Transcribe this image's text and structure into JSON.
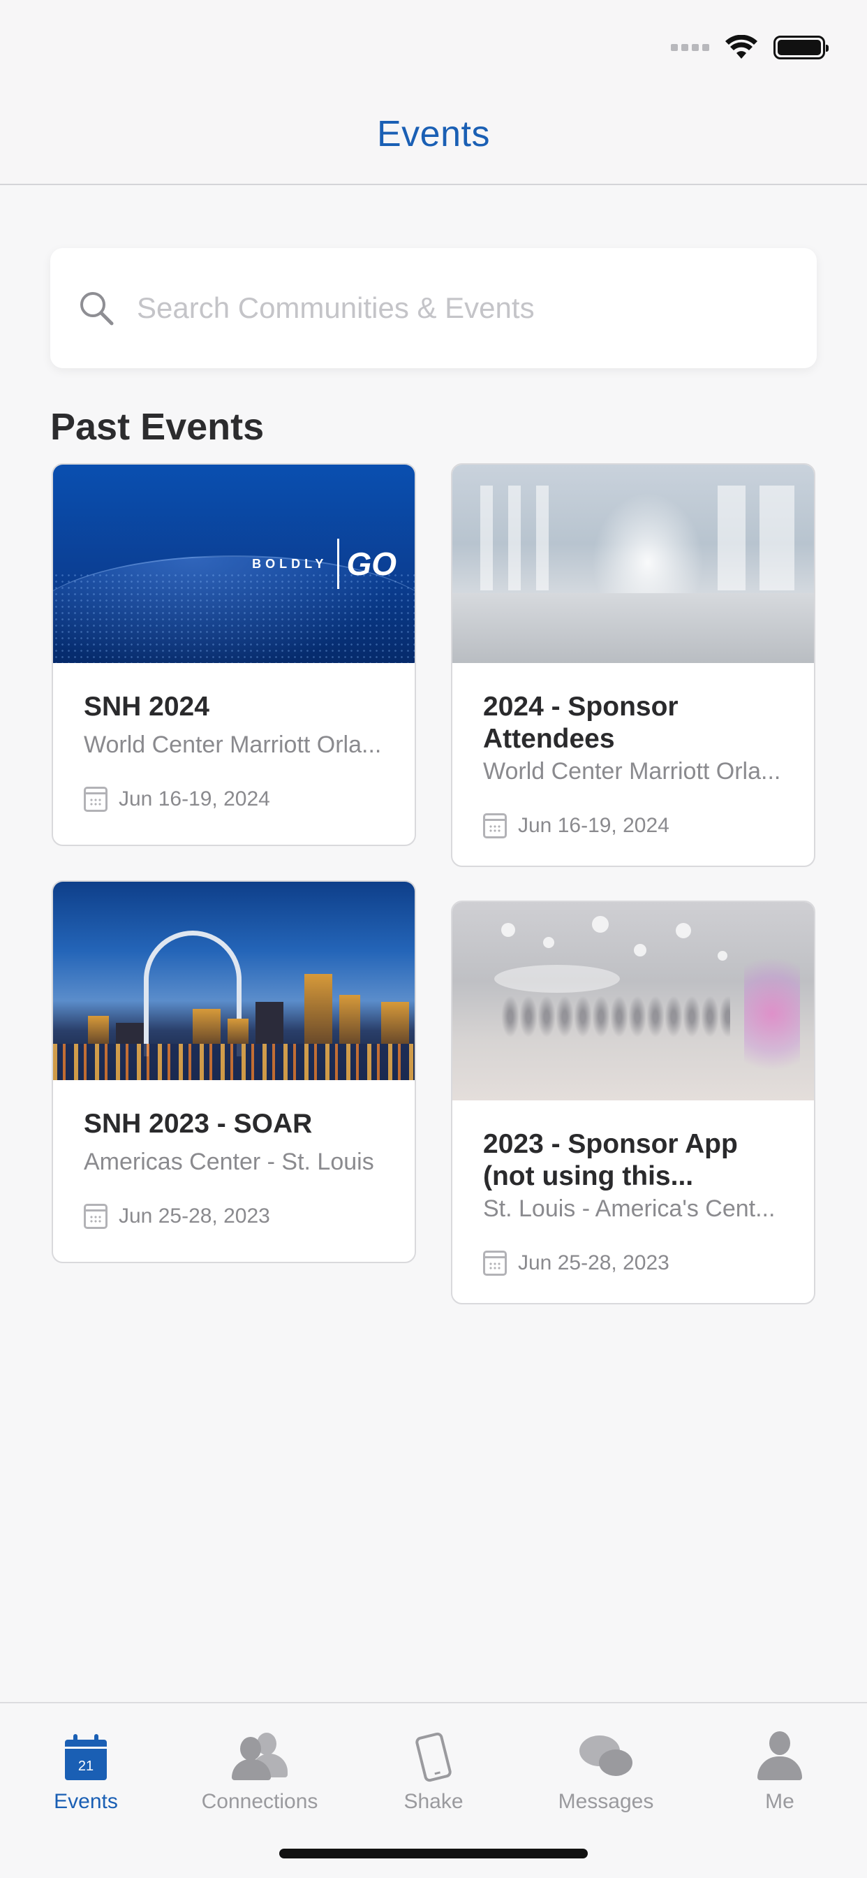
{
  "header": {
    "title": "Events"
  },
  "search": {
    "placeholder": "Search Communities & Events"
  },
  "section": {
    "title": "Past Events"
  },
  "events": [
    {
      "title": "SNH 2024",
      "venue": "World Center Marriott Orla...",
      "date": "Jun 16-19, 2024",
      "image": "boldly-go-banner",
      "logo_small": "BOLDLY",
      "logo_big": "GO"
    },
    {
      "title": "2024 - Sponsor Attendees",
      "venue": "World Center Marriott Orla...",
      "date": "Jun 16-19, 2024",
      "image": "convention-hall-photo"
    },
    {
      "title": "SNH 2023 - SOAR",
      "venue": "Americas Center - St. Louis",
      "date": "Jun 25-28, 2023",
      "image": "st-louis-skyline-photo"
    },
    {
      "title": "2023 - Sponsor App (not using this...",
      "venue": "St. Louis - America's Cent...",
      "date": "Jun 25-28, 2023",
      "image": "expo-floor-photo"
    }
  ],
  "tabbar": {
    "calendar_day": "21",
    "items": [
      {
        "label": "Events",
        "icon": "calendar-icon",
        "active": true
      },
      {
        "label": "Connections",
        "icon": "people-icon",
        "active": false
      },
      {
        "label": "Shake",
        "icon": "phone-shake-icon",
        "active": false
      },
      {
        "label": "Messages",
        "icon": "chat-bubbles-icon",
        "active": false
      },
      {
        "label": "Me",
        "icon": "person-icon",
        "active": false
      }
    ]
  },
  "colors": {
    "accent": "#1a5fb4",
    "inactive": "#9a9a9e",
    "background": "#f7f7f8"
  }
}
